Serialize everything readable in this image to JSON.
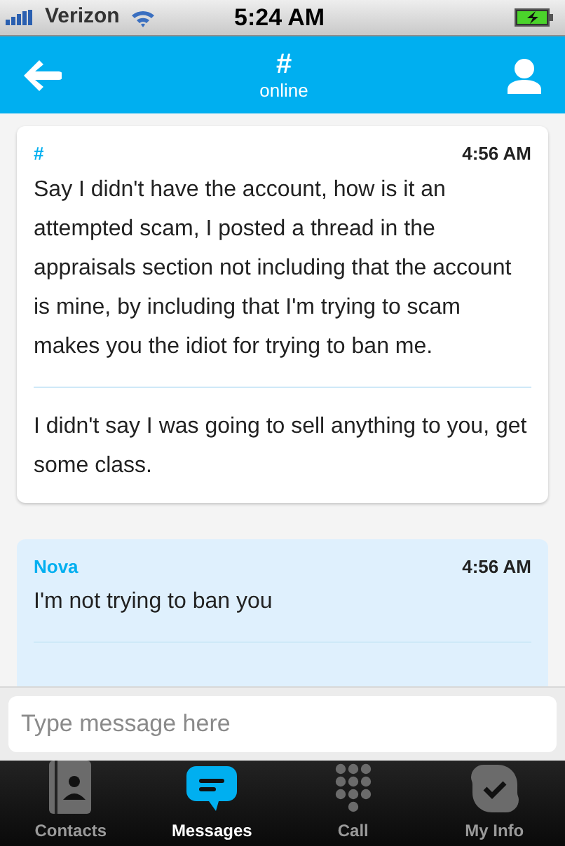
{
  "status_bar": {
    "carrier": "Verizon",
    "time": "5:24 AM"
  },
  "header": {
    "title": "#",
    "subtitle": "online"
  },
  "messages": [
    {
      "kind": "incoming",
      "sender": "#",
      "time": "4:56 AM",
      "parts": [
        "Say I didn't have the account, how is it an attempted scam, I posted a thread in the appraisals section not including that the account is mine, by including that I'm trying to scam makes you the idiot for trying to ban me.",
        "I didn't say I was going to sell anything to you, get some class."
      ]
    },
    {
      "kind": "outgoing",
      "sender": "Nova",
      "time": "4:56 AM",
      "parts": [
        "I'm not trying to ban you"
      ]
    }
  ],
  "composer": {
    "placeholder": "Type message here"
  },
  "tabs": [
    {
      "kind": "contacts",
      "label": "Contacts",
      "selected": false
    },
    {
      "kind": "messages",
      "label": "Messages",
      "selected": true
    },
    {
      "kind": "call",
      "label": "Call",
      "selected": false
    },
    {
      "kind": "info",
      "label": "My Info",
      "selected": false
    }
  ]
}
